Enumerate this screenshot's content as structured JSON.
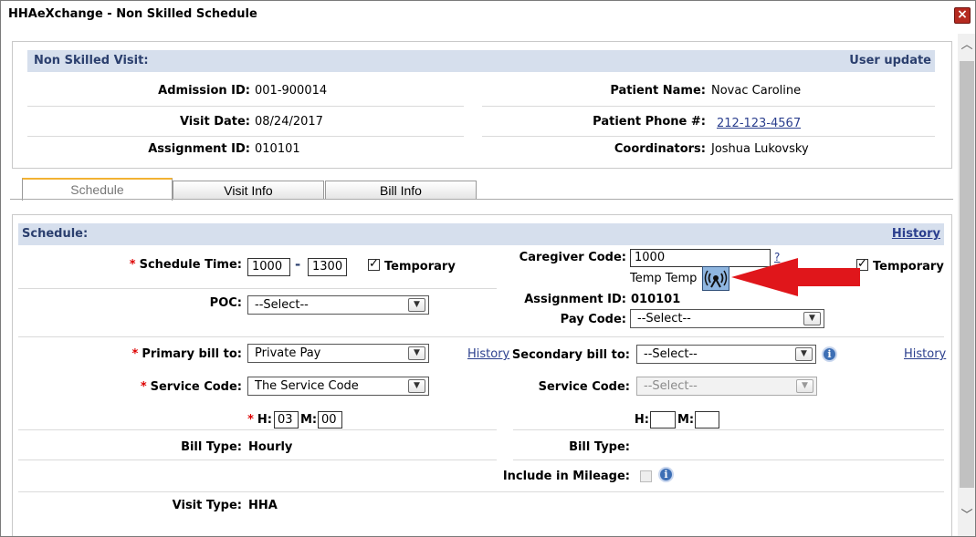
{
  "window": {
    "title": "HHAeXchange - Non Skilled Schedule",
    "close_label": "×"
  },
  "header": {
    "section_title": "Non Skilled Visit:",
    "user_update": "User update",
    "admission_id_label": "Admission ID:",
    "admission_id": "001-900014",
    "patient_name_label": "Patient Name:",
    "patient_name": "Novac Caroline",
    "visit_date_label": "Visit Date:",
    "visit_date": "08/24/2017",
    "patient_phone_label": "Patient Phone #:",
    "patient_phone": "212-123-4567",
    "assignment_id_label": "Assignment ID:",
    "assignment_id": "010101",
    "coordinators_label": "Coordinators:",
    "coordinators": "Joshua Lukovsky"
  },
  "tabs": [
    {
      "label": "Schedule",
      "active": true
    },
    {
      "label": "Visit Info",
      "active": false
    },
    {
      "label": "Bill Info",
      "active": false
    }
  ],
  "schedule": {
    "section_title": "Schedule:",
    "history_link": "History",
    "required_mark": "*",
    "schedule_time_label": "Schedule Time:",
    "time_start": "1000",
    "time_dash": "-",
    "time_end": "1300",
    "temporary_label": "Temporary",
    "temporary_checked": "✓",
    "caregiver_code_label": "Caregiver Code:",
    "caregiver_code": "1000",
    "caregiver_help": "?",
    "caregiver_name": "Temp Temp",
    "caregiver_temporary_label": "Temporary",
    "caregiver_temporary_checked": "✓",
    "poc_label": "POC:",
    "poc_value": "--Select--",
    "assignment_id_label": "Assignment ID:",
    "assignment_id": "010101",
    "pay_code_label": "Pay Code:",
    "pay_code_value": "--Select--",
    "primary_bill_label": "Primary bill to:",
    "primary_bill_value": "Private Pay",
    "primary_history": "History",
    "secondary_bill_label": "Secondary bill to:",
    "secondary_bill_value": "--Select--",
    "secondary_history": "History",
    "service_code_label": "Service Code:",
    "service_code_value": "The Service Code",
    "secondary_service_code_label": "Service Code:",
    "secondary_service_code_value": "--Select--",
    "h_label": "H:",
    "h_value": "03",
    "m_label": "M:",
    "m_value": "00",
    "secondary_h_label": "H:",
    "secondary_h_value": "",
    "secondary_m_label": "M:",
    "secondary_m_value": "",
    "bill_type_label": "Bill Type:",
    "bill_type_value": "Hourly",
    "secondary_bill_type_label": "Bill Type:",
    "secondary_bill_type_value": "",
    "include_mileage_label": "Include in Mileage:",
    "visit_type_label": "Visit Type:",
    "visit_type_value": "HHA"
  },
  "icons": {
    "close": "close-icon",
    "info": "info-icon",
    "radio_tower": "radio-tower-icon",
    "dropdown": "chevron-down-icon",
    "annotation_arrow": "red-arrow-icon"
  },
  "colors": {
    "section_bar": "#d6dfed",
    "section_text": "#2b3f6e",
    "required": "#dd0000",
    "arrow": "#e0161b",
    "tab_accent": "#f2b233"
  }
}
